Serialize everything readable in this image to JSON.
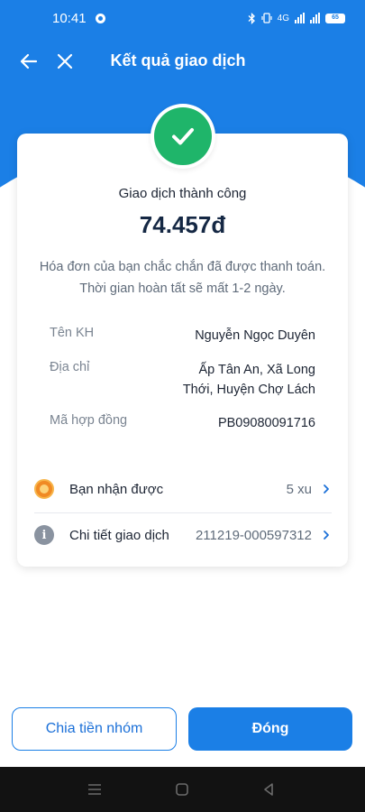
{
  "status_bar": {
    "time": "10:41",
    "network_label": "4G",
    "battery": "65"
  },
  "header": {
    "title": "Kết quả giao dịch",
    "back_icon": "arrow-left-icon",
    "close_icon": "close-icon"
  },
  "result": {
    "status": "Giao dịch thành công",
    "amount": "74.457đ",
    "note_line1": "Hóa đơn của bạn chắc chắn đã được thanh toán.",
    "note_line2": "Thời gian hoàn tất sẽ mất 1-2 ngày.",
    "success_icon": "checkmark-icon",
    "success_color": "#1fb56a"
  },
  "details": [
    {
      "label": "Tên KH",
      "value_lines": [
        "Nguyễn Ngọc Duyên"
      ]
    },
    {
      "label": "Địa chỉ",
      "value_lines": [
        "Ấp Tân An, Xã Long",
        "Thới, Huyện Chợ Lách"
      ]
    },
    {
      "label": "Mã hợp đồng",
      "value_lines": [
        "PB09080091716"
      ]
    }
  ],
  "links": [
    {
      "label": "Bạn nhận được",
      "value": "5 xu",
      "icon": "coin-icon"
    },
    {
      "label": "Chi tiết giao dịch",
      "value": "211219-000597312",
      "icon": "info-icon"
    }
  ],
  "buttons": {
    "split": "Chia tiền nhóm",
    "close": "Đóng"
  },
  "colors": {
    "brand_blue": "#1b7fe6",
    "success_green": "#1fb56a"
  }
}
